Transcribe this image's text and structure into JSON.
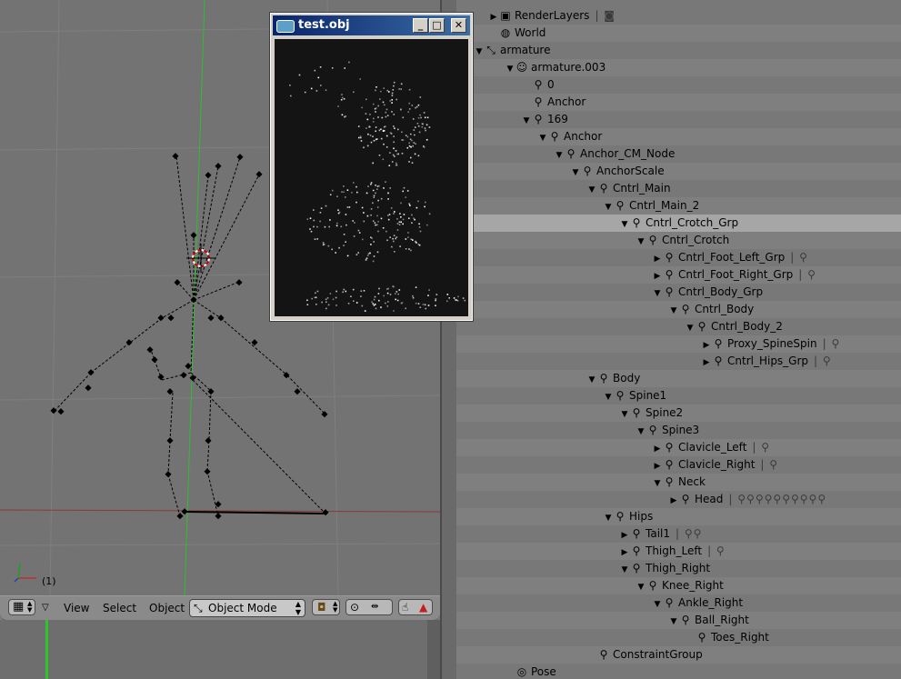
{
  "viewport": {
    "frame_label": "(1)",
    "header": {
      "menu_view": "View",
      "menu_select": "Select",
      "menu_object": "Object",
      "mode": "Object Mode"
    }
  },
  "float_window": {
    "title": "test.obj",
    "minimize": "_",
    "maximize": "□",
    "close": "✕"
  },
  "outliner": {
    "rows": [
      {
        "indent": 0,
        "tri": "▶",
        "icon": "▣",
        "label": "RenderLayers",
        "extra": "|  ◙"
      },
      {
        "indent": 0,
        "tri": "",
        "icon": "◍",
        "label": "World",
        "extra": ""
      },
      {
        "indent": -1,
        "tri": "▼",
        "icon": "⤡",
        "label": "armature",
        "extra": ""
      },
      {
        "indent": 1,
        "tri": "▼",
        "icon": "☺",
        "label": "armature.003",
        "extra": ""
      },
      {
        "indent": 2,
        "tri": "",
        "icon": "⚲",
        "label": "0",
        "extra": ""
      },
      {
        "indent": 2,
        "tri": "",
        "icon": "⚲",
        "label": "Anchor",
        "extra": ""
      },
      {
        "indent": 2,
        "tri": "▼",
        "icon": "⚲",
        "label": "169",
        "extra": ""
      },
      {
        "indent": 3,
        "tri": "▼",
        "icon": "⚲",
        "label": "Anchor",
        "extra": ""
      },
      {
        "indent": 4,
        "tri": "▼",
        "icon": "⚲",
        "label": "Anchor_CM_Node",
        "extra": ""
      },
      {
        "indent": 5,
        "tri": "▼",
        "icon": "⚲",
        "label": "AnchorScale",
        "extra": ""
      },
      {
        "indent": 6,
        "tri": "▼",
        "icon": "⚲",
        "label": "Cntrl_Main",
        "extra": ""
      },
      {
        "indent": 7,
        "tri": "▼",
        "icon": "⚲",
        "label": "Cntrl_Main_2",
        "extra": ""
      },
      {
        "indent": 8,
        "tri": "▼",
        "icon": "⚲",
        "label": "Cntrl_Crotch_Grp",
        "extra": "",
        "sel": true
      },
      {
        "indent": 9,
        "tri": "▼",
        "icon": "⚲",
        "label": "Cntrl_Crotch",
        "extra": ""
      },
      {
        "indent": 10,
        "tri": "▶",
        "icon": "⚲",
        "label": "Cntrl_Foot_Left_Grp",
        "extra": "|  ⚲"
      },
      {
        "indent": 10,
        "tri": "▶",
        "icon": "⚲",
        "label": "Cntrl_Foot_Right_Grp",
        "extra": "|  ⚲"
      },
      {
        "indent": 10,
        "tri": "▼",
        "icon": "⚲",
        "label": "Cntrl_Body_Grp",
        "extra": ""
      },
      {
        "indent": 11,
        "tri": "▼",
        "icon": "⚲",
        "label": "Cntrl_Body",
        "extra": ""
      },
      {
        "indent": 12,
        "tri": "▼",
        "icon": "⚲",
        "label": "Cntrl_Body_2",
        "extra": ""
      },
      {
        "indent": 13,
        "tri": "▶",
        "icon": "⚲",
        "label": "Proxy_SpineSpin",
        "extra": "|  ⚲"
      },
      {
        "indent": 13,
        "tri": "▶",
        "icon": "⚲",
        "label": "Cntrl_Hips_Grp",
        "extra": "|  ⚲"
      },
      {
        "indent": 6,
        "tri": "▼",
        "icon": "⚲",
        "label": "Body",
        "extra": ""
      },
      {
        "indent": 7,
        "tri": "▼",
        "icon": "⚲",
        "label": "Spine1",
        "extra": ""
      },
      {
        "indent": 8,
        "tri": "▼",
        "icon": "⚲",
        "label": "Spine2",
        "extra": ""
      },
      {
        "indent": 9,
        "tri": "▼",
        "icon": "⚲",
        "label": "Spine3",
        "extra": ""
      },
      {
        "indent": 10,
        "tri": "▶",
        "icon": "⚲",
        "label": "Clavicle_Left",
        "extra": "|  ⚲"
      },
      {
        "indent": 10,
        "tri": "▶",
        "icon": "⚲",
        "label": "Clavicle_Right",
        "extra": "|  ⚲"
      },
      {
        "indent": 10,
        "tri": "▼",
        "icon": "⚲",
        "label": "Neck",
        "extra": ""
      },
      {
        "indent": 11,
        "tri": "▶",
        "icon": "⚲",
        "label": "Head",
        "extra": "|  ⚲⚲⚲⚲⚲⚲⚲⚲⚲⚲"
      },
      {
        "indent": 7,
        "tri": "▼",
        "icon": "⚲",
        "label": "Hips",
        "extra": ""
      },
      {
        "indent": 8,
        "tri": "▶",
        "icon": "⚲",
        "label": "Tail1",
        "extra": "|  ⚲⚲"
      },
      {
        "indent": 8,
        "tri": "▶",
        "icon": "⚲",
        "label": "Thigh_Left",
        "extra": "|  ⚲"
      },
      {
        "indent": 8,
        "tri": "▼",
        "icon": "⚲",
        "label": "Thigh_Right",
        "extra": ""
      },
      {
        "indent": 9,
        "tri": "▼",
        "icon": "⚲",
        "label": "Knee_Right",
        "extra": ""
      },
      {
        "indent": 10,
        "tri": "▼",
        "icon": "⚲",
        "label": "Ankle_Right",
        "extra": ""
      },
      {
        "indent": 11,
        "tri": "▼",
        "icon": "⚲",
        "label": "Ball_Right",
        "extra": ""
      },
      {
        "indent": 12,
        "tri": "",
        "icon": "⚲",
        "label": "Toes_Right",
        "extra": ""
      },
      {
        "indent": 6,
        "tri": "",
        "icon": "⚲",
        "label": "ConstraintGroup",
        "extra": ""
      },
      {
        "indent": 1,
        "tri": "",
        "icon": "◎",
        "label": "Pose",
        "extra": ""
      }
    ]
  }
}
